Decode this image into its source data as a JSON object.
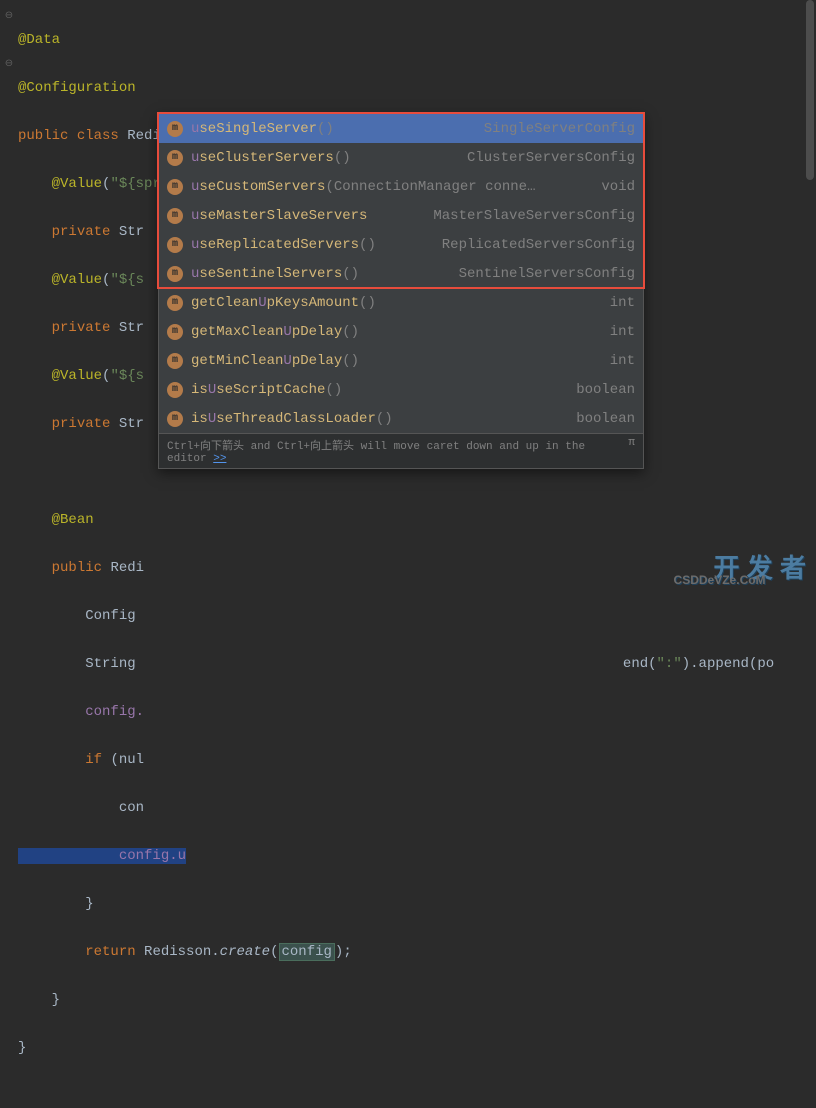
{
  "code": {
    "ann_data": "@Data",
    "ann_config": "@Configuration",
    "public": "public",
    "class": "class",
    "className": "RedissonConfig",
    "ann_value": "@Value",
    "val1": "\"${spring.redis.host}\"",
    "private": "private",
    "strType": "Str",
    "val2": "\"${s",
    "ann_bean": "@Bean",
    "rediType": "Redi",
    "configVar": "Config",
    "stringVar": "String",
    "append1": "end(",
    "append1str": "\":\"",
    "append2": ").append(po",
    "configDot": "config.",
    "if": "if",
    "null": "(nul",
    "con": "con",
    "configU": "config.",
    "uChar": "u",
    "return": "return",
    "redisson": "Redisson.",
    "create": "create",
    "configParam": "config"
  },
  "autocomplete": {
    "items": [
      {
        "pre": "u",
        "mid": "se",
        "rest": "SingleServer",
        "params": "()",
        "ret": "SingleServerConfig",
        "selected": true
      },
      {
        "pre": "u",
        "mid": "se",
        "rest": "ClusterServers",
        "params": "()",
        "ret": "ClusterServersConfig",
        "selected": false
      },
      {
        "pre": "u",
        "mid": "se",
        "rest": "CustomServers",
        "params": "(ConnectionManager conne…",
        "ret": "void",
        "selected": false
      },
      {
        "pre": "u",
        "mid": "se",
        "rest": "MasterSlaveServers",
        "params": "",
        "ret": "MasterSlaveServersConfig",
        "selected": false
      },
      {
        "pre": "u",
        "mid": "se",
        "rest": "ReplicatedServers",
        "params": "()",
        "ret": "ReplicatedServersConfig",
        "selected": false
      },
      {
        "pre": "u",
        "mid": "se",
        "rest": "SentinelServers",
        "params": "()",
        "ret": "SentinelServersConfig",
        "selected": false
      },
      {
        "pre": "",
        "mid": "",
        "rest": "getCleanUpKeysAmount",
        "params": "()",
        "ret": "int",
        "selected": false,
        "hl": "U"
      },
      {
        "pre": "",
        "mid": "",
        "rest": "getMaxCleanUpDelay",
        "params": "()",
        "ret": "int",
        "selected": false,
        "hl": "U"
      },
      {
        "pre": "",
        "mid": "",
        "rest": "getMinCleanUpDelay",
        "params": "()",
        "ret": "int",
        "selected": false,
        "hl": "U"
      },
      {
        "pre": "",
        "mid": "",
        "rest": "isUseScriptCache",
        "params": "()",
        "ret": "boolean",
        "selected": false,
        "hl": "U"
      },
      {
        "pre": "",
        "mid": "",
        "rest": "isUseThreadClassLoader",
        "params": "()",
        "ret": "boolean",
        "selected": false,
        "hl": "U"
      }
    ],
    "hint": "Ctrl+向下箭头 and Ctrl+向上箭头 will move caret down and up in the editor",
    "hintLink": ">>",
    "pi": "π"
  },
  "watermark": {
    "main": "开 发 者",
    "sub": "CSDDeVZe.CoM"
  }
}
